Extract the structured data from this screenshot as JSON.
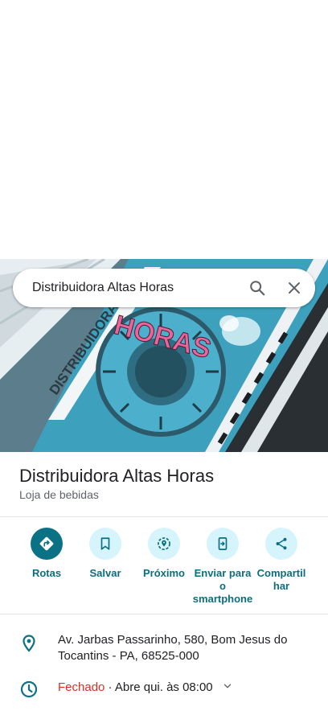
{
  "search": {
    "query": "Distribuidora Altas Horas"
  },
  "place": {
    "name": "Distribuidora Altas Horas",
    "category": "Loja de bebidas"
  },
  "hero_sign": {
    "sign_text": "DISTRIBUIDORA",
    "sign_text2": "HORAS"
  },
  "actions": [
    {
      "label": "Rotas",
      "icon": "directions-icon"
    },
    {
      "label": "Salvar",
      "icon": "bookmark-icon"
    },
    {
      "label": "Próximo",
      "icon": "nearby-icon"
    },
    {
      "label": "Enviar para o smartphone",
      "icon": "send-to-phone-icon"
    },
    {
      "label": "Compartilhar",
      "icon": "share-icon"
    }
  ],
  "info": {
    "address": "Av. Jarbas Passarinho, 580, Bom Jesus do Tocantins - PA, 68525-000",
    "hours_status": "Fechado",
    "hours_detail": " · Abre qui. às 08:00"
  },
  "colors": {
    "accent": "#0b7285",
    "action_bg": "#d6f4fb",
    "closed": "#d93025"
  }
}
